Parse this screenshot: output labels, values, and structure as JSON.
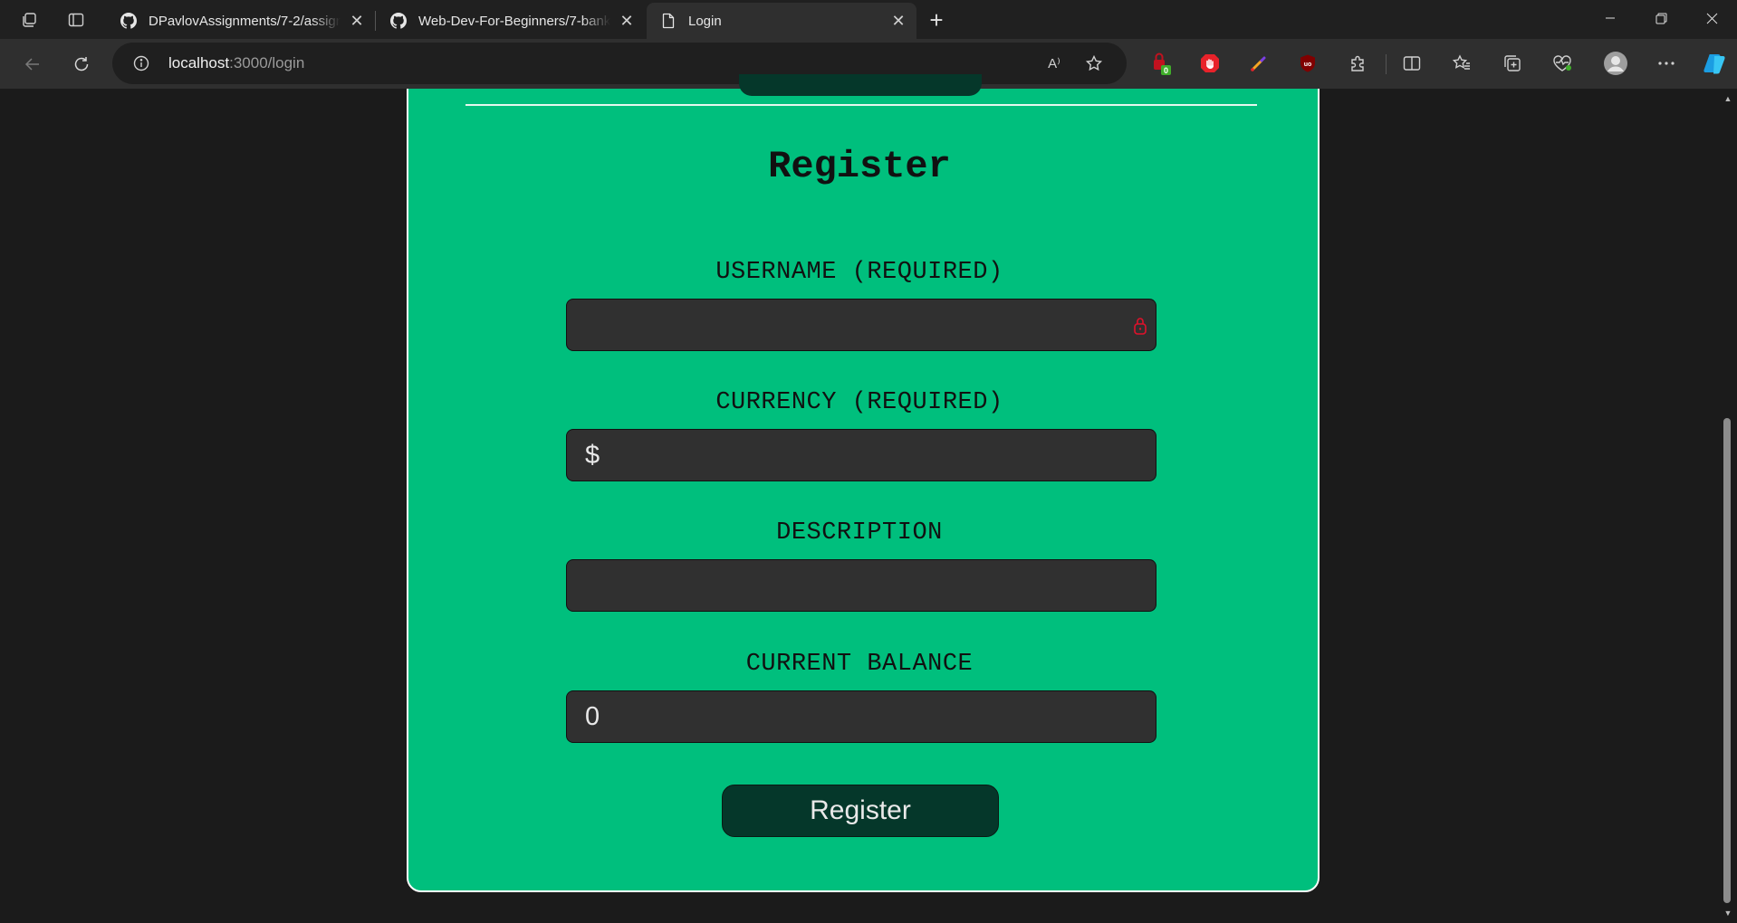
{
  "browser": {
    "tabs": [
      {
        "label": "DPavlovAssignments/7-2/assignm",
        "icon": "github-icon",
        "active": false
      },
      {
        "label": "Web-Dev-For-Beginners/7-bank-",
        "icon": "github-icon",
        "active": false
      },
      {
        "label": "Login",
        "icon": "page-icon",
        "active": true
      }
    ],
    "new_tab_symbol": "+",
    "address": {
      "host": "localhost",
      "path": ":3000/login"
    },
    "extension_badge": "0",
    "read_aloud_symbol": "A⁾"
  },
  "page": {
    "title": "Register",
    "fields": [
      {
        "label": "USERNAME (REQUIRED)",
        "value": "",
        "placeholder": ""
      },
      {
        "label": "CURRENCY (REQUIRED)",
        "value": "$",
        "placeholder": ""
      },
      {
        "label": "DESCRIPTION",
        "value": "",
        "placeholder": ""
      },
      {
        "label": "CURRENT BALANCE",
        "value": "0",
        "placeholder": ""
      }
    ],
    "submit_label": "Register"
  },
  "colors": {
    "card_background": "#00bf7d",
    "button_background": "#05372a",
    "input_background": "#303030",
    "page_background": "#1b1b1b"
  }
}
